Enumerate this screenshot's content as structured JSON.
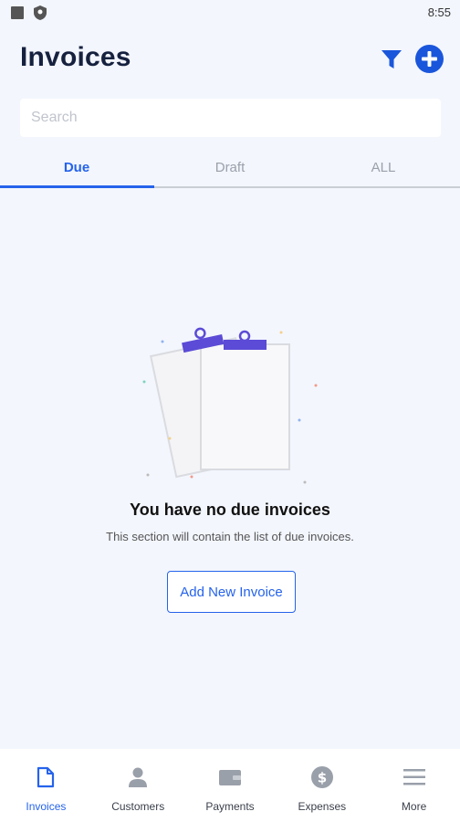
{
  "status_bar": {
    "time": "8:55"
  },
  "header": {
    "title": "Invoices"
  },
  "search": {
    "placeholder": "Search",
    "value": ""
  },
  "tabs": [
    {
      "label": "Due",
      "active": true
    },
    {
      "label": "Draft",
      "active": false
    },
    {
      "label": "ALL",
      "active": false
    }
  ],
  "empty_state": {
    "title": "You have no due invoices",
    "description": "This section will contain the list of due invoices.",
    "button_label": "Add New Invoice"
  },
  "bottom_nav": [
    {
      "label": "Invoices",
      "icon": "document-icon",
      "active": true
    },
    {
      "label": "Customers",
      "icon": "person-icon",
      "active": false
    },
    {
      "label": "Payments",
      "icon": "wallet-icon",
      "active": false
    },
    {
      "label": "Expenses",
      "icon": "dollar-icon",
      "active": false
    },
    {
      "label": "More",
      "icon": "menu-icon",
      "active": false
    }
  ],
  "colors": {
    "accent": "#2563eb",
    "title": "#16213e",
    "background": "#f3f6fd",
    "clip": "#5b4bd6"
  }
}
